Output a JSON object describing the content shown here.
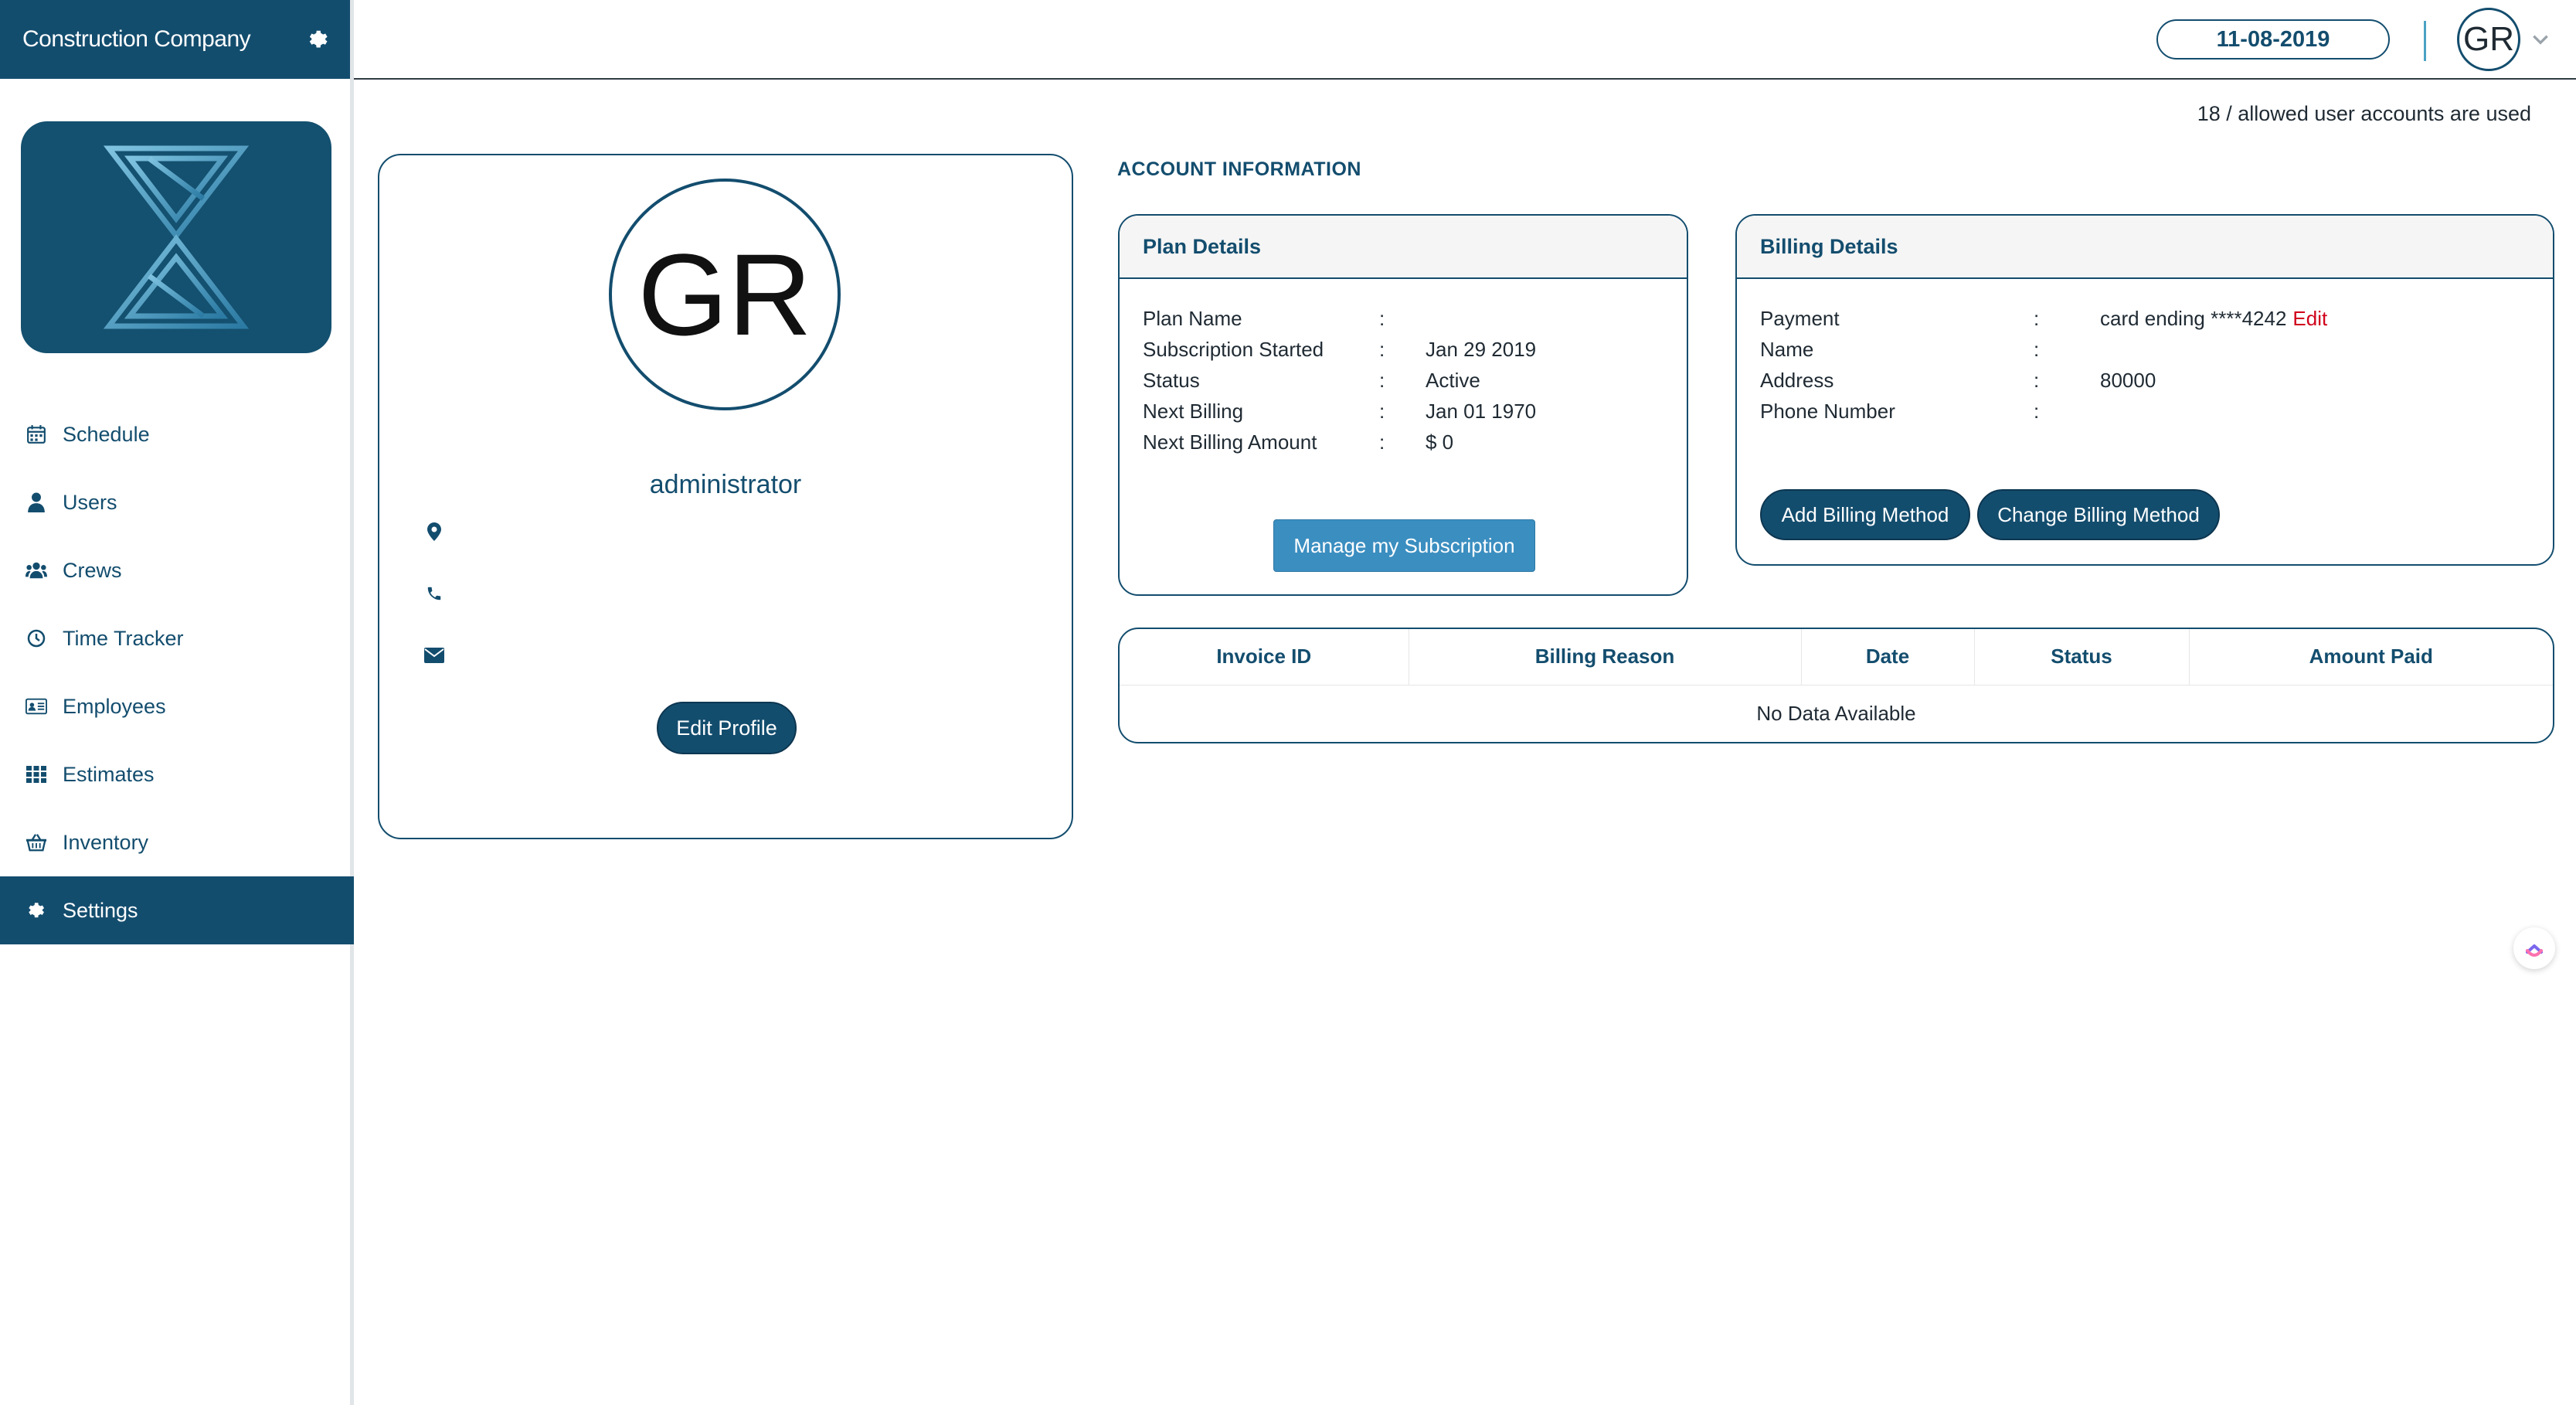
{
  "app": {
    "brand_name": "Construction Company",
    "colors": {
      "primary": "#134d6e",
      "accent_button": "#3b8ec0",
      "edit_link": "#d0021b"
    }
  },
  "sidebar": {
    "items": [
      {
        "label": "Schedule",
        "icon": "calendar-icon"
      },
      {
        "label": "Users",
        "icon": "user-icon"
      },
      {
        "label": "Crews",
        "icon": "group-icon"
      },
      {
        "label": "Time Tracker",
        "icon": "clock-icon"
      },
      {
        "label": "Employees",
        "icon": "id-card-icon"
      },
      {
        "label": "Estimates",
        "icon": "grid-icon"
      },
      {
        "label": "Inventory",
        "icon": "basket-icon"
      },
      {
        "label": "Settings",
        "icon": "gear-icon",
        "active": true
      }
    ]
  },
  "topbar": {
    "date": "11-08-2019",
    "avatar_initials": "GR"
  },
  "main": {
    "accounts_used": "18 / allowed user accounts are used",
    "profile": {
      "initials": "GR",
      "role": "administrator",
      "edit_label": "Edit Profile"
    },
    "account_title": "ACCOUNT INFORMATION",
    "plan": {
      "title": "Plan Details",
      "rows": [
        {
          "key": "Plan Name",
          "sep": ":",
          "value": ""
        },
        {
          "key": "Subscription Started",
          "sep": ":",
          "value": "Jan 29 2019"
        },
        {
          "key": "Status",
          "sep": ":",
          "value": "Active"
        },
        {
          "key": "Next Billing",
          "sep": ":",
          "value": "Jan 01 1970"
        },
        {
          "key": "Next Billing Amount",
          "sep": ":",
          "value": "$ 0"
        }
      ],
      "manage_label": "Manage my Subscription"
    },
    "billing": {
      "title": "Billing Details",
      "rows": [
        {
          "key": "Payment",
          "sep": ":",
          "value": "card ending ****4242",
          "link": "Edit"
        },
        {
          "key": "Name",
          "sep": ":",
          "value": ""
        },
        {
          "key": "Address",
          "sep": ":",
          "value": "80000"
        },
        {
          "key": "Phone Number",
          "sep": ":",
          "value": ""
        }
      ],
      "add_label": "Add Billing Method",
      "change_label": "Change Billing Method"
    },
    "invoices": {
      "columns": [
        "Invoice ID",
        "Billing Reason",
        "Date",
        "Status",
        "Amount Paid"
      ],
      "empty_text": "No Data Available"
    }
  }
}
